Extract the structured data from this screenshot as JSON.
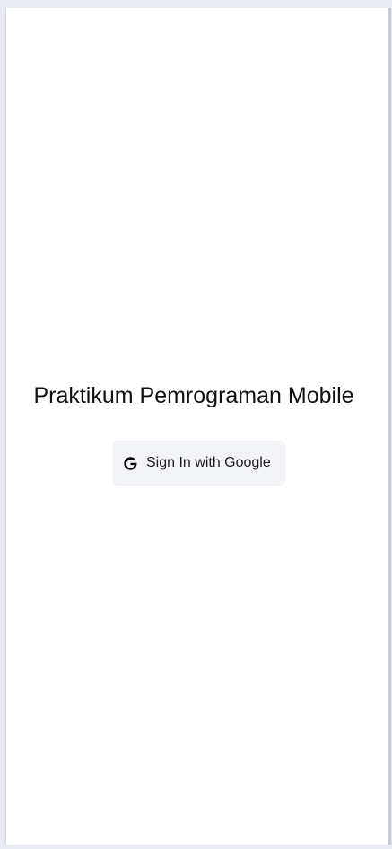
{
  "app": {
    "title": "Praktikum Pemrograman Mobile"
  },
  "auth": {
    "google_button_label": "Sign In with Google",
    "google_icon": "google-icon"
  },
  "colors": {
    "background": "#ffffff",
    "button_background": "#f3f4f7",
    "text": "#111111"
  }
}
